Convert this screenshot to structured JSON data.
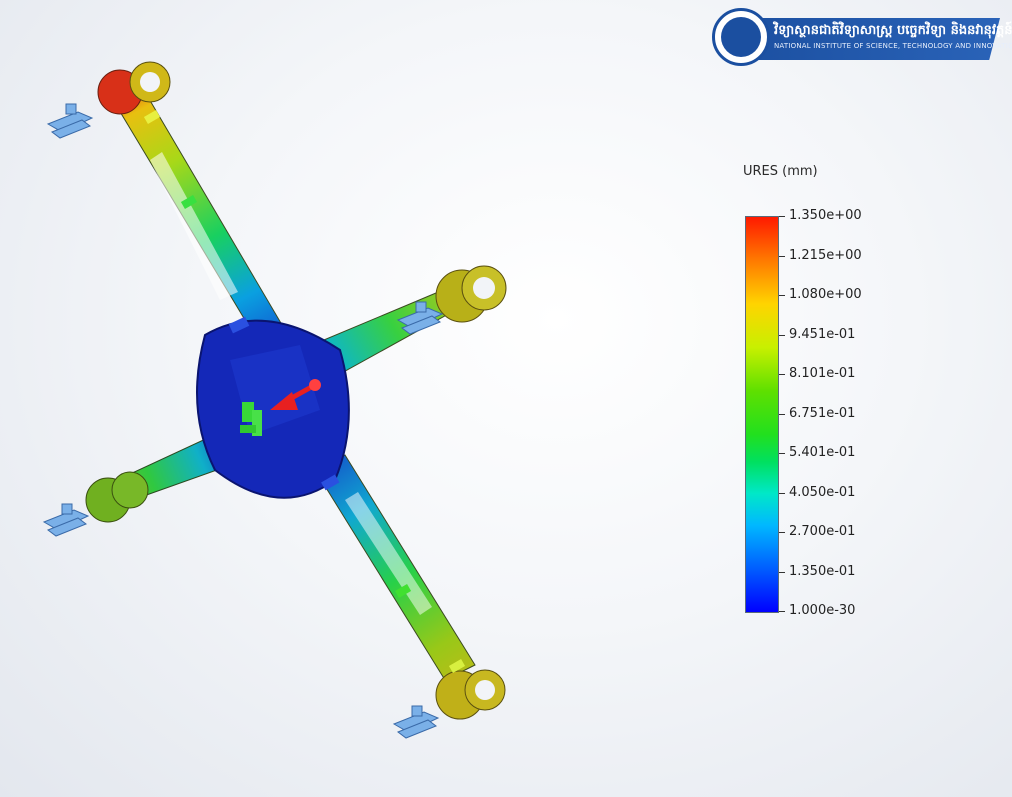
{
  "logo": {
    "khmer_text": "វិទ្យាស្ថានជាតិវិទ្យាសាស្ត្រ បច្ចេកវិទ្យា និងនវានុវត្តន៍",
    "english_text": "NATIONAL INSTITUTE OF SCIENCE, TECHNOLOGY AND INNOVATION",
    "brand_color": "#1b4fa0"
  },
  "legend": {
    "title": "URES (mm)",
    "ticks": [
      "1.350e+00",
      "1.215e+00",
      "1.080e+00",
      "9.451e-01",
      "8.101e-01",
      "6.751e-01",
      "5.401e-01",
      "4.050e-01",
      "2.700e-01",
      "1.350e-01",
      "1.000e-30"
    ],
    "colors": [
      "#ff1a00",
      "#ff7a00",
      "#ffd400",
      "#c8f000",
      "#5fe000",
      "#22e01e",
      "#00e060",
      "#00e8c8",
      "#00b8ff",
      "#0066ff",
      "#0000ff"
    ]
  },
  "model": {
    "body_color": "#1428b8",
    "fixture_color": "#7ab0e8",
    "load_arrow_color": "#e82020",
    "icons": [
      "fixture-arrow-icon",
      "load-arrow-icon",
      "green-fixture-icon"
    ]
  }
}
